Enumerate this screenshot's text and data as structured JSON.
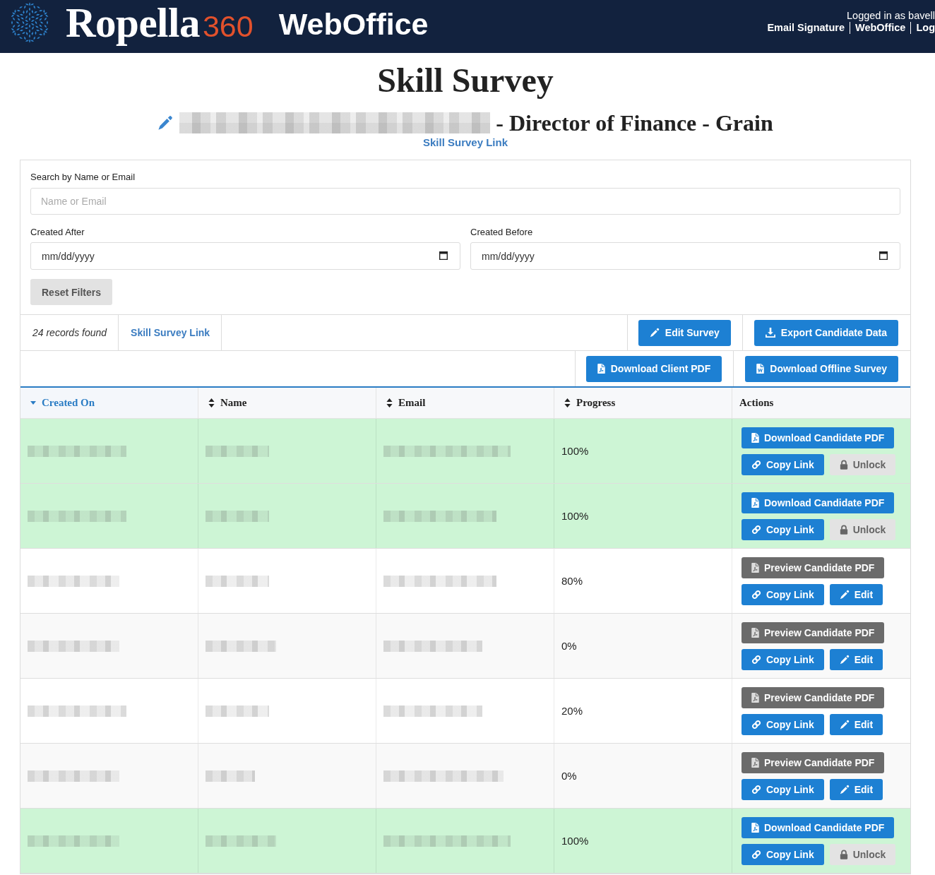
{
  "header": {
    "brand": {
      "name": "Ropella",
      "suffix": "360"
    },
    "app_name": "WebOffice",
    "user_line": "Logged in as bavell",
    "links": [
      "Email Signature",
      "WebOffice",
      "Log"
    ]
  },
  "heading": {
    "title": "Skill Survey",
    "subtitle": "- Director of Finance - Grain",
    "link": "Skill Survey Link"
  },
  "filters": {
    "search": {
      "label": "Search by Name or Email",
      "placeholder": "Name or Email"
    },
    "dates": [
      {
        "label": "Created After",
        "placeholder": "mm/dd/yyyy"
      },
      {
        "label": "Created Before",
        "placeholder": "mm/dd/yyyy"
      }
    ],
    "reset_button": "Reset Filters"
  },
  "toolbar": {
    "record_count": "24 records found",
    "link": "Skill Survey Link",
    "button_rows": [
      [
        {
          "label": "Edit Survey",
          "kind": "edit"
        },
        {
          "label": "Export Candidate Data",
          "kind": "export"
        }
      ],
      [
        {
          "label": "Download Client PDF",
          "kind": "pdf"
        },
        {
          "label": "Download Offline Survey",
          "kind": "word"
        }
      ]
    ]
  },
  "table": {
    "columns": [
      {
        "label": "Created On",
        "sortable": true,
        "sorted": true,
        "descending": true
      },
      {
        "label": "Name",
        "sortable": true,
        "sorted": false
      },
      {
        "label": "Email",
        "sortable": true,
        "sorted": false
      },
      {
        "label": "Progress",
        "sortable": true,
        "sorted": false
      },
      {
        "label": "Actions",
        "sortable": false,
        "sorted": false
      }
    ],
    "rows": [
      {
        "progress": "100%",
        "highlighted": true,
        "action_rows": [
          [
            {
              "label": "Download Candidate PDF",
              "kind": "pdf"
            }
          ],
          [
            {
              "label": "Copy Link",
              "kind": "link"
            },
            {
              "label": "Unlock",
              "kind": "unlock"
            }
          ]
        ]
      },
      {
        "progress": "100%",
        "highlighted": true,
        "action_rows": [
          [
            {
              "label": "Download Candidate PDF",
              "kind": "pdf"
            }
          ],
          [
            {
              "label": "Copy Link",
              "kind": "link"
            },
            {
              "label": "Unlock",
              "kind": "unlock"
            }
          ]
        ]
      },
      {
        "progress": "80%",
        "highlighted": false,
        "action_rows": [
          [
            {
              "label": "Preview Candidate PDF",
              "kind": "preview"
            }
          ],
          [
            {
              "label": "Copy Link",
              "kind": "link"
            },
            {
              "label": "Edit",
              "kind": "edit"
            }
          ]
        ]
      },
      {
        "progress": "0%",
        "highlighted": false,
        "action_rows": [
          [
            {
              "label": "Preview Candidate PDF",
              "kind": "preview"
            }
          ],
          [
            {
              "label": "Copy Link",
              "kind": "link"
            },
            {
              "label": "Edit",
              "kind": "edit"
            }
          ]
        ]
      },
      {
        "progress": "20%",
        "highlighted": false,
        "action_rows": [
          [
            {
              "label": "Preview Candidate PDF",
              "kind": "preview"
            }
          ],
          [
            {
              "label": "Copy Link",
              "kind": "link"
            },
            {
              "label": "Edit",
              "kind": "edit"
            }
          ]
        ]
      },
      {
        "progress": "0%",
        "highlighted": false,
        "action_rows": [
          [
            {
              "label": "Preview Candidate PDF",
              "kind": "preview"
            }
          ],
          [
            {
              "label": "Copy Link",
              "kind": "link"
            },
            {
              "label": "Edit",
              "kind": "edit"
            }
          ]
        ]
      },
      {
        "progress": "100%",
        "highlighted": true,
        "action_rows": [
          [
            {
              "label": "Download Candidate PDF",
              "kind": "pdf"
            }
          ],
          [
            {
              "label": "Copy Link",
              "kind": "link"
            },
            {
              "label": "Unlock",
              "kind": "unlock"
            }
          ]
        ]
      }
    ]
  }
}
